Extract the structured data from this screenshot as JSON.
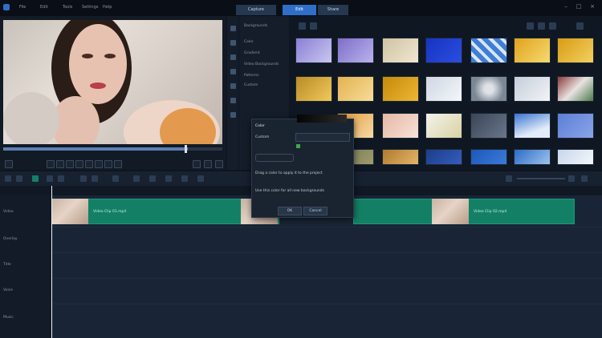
{
  "menu": {
    "items": [
      "File",
      "Edit",
      "Tools",
      "Settings",
      "Help"
    ]
  },
  "workflow_tabs": [
    {
      "label": "Capture",
      "active": false
    },
    {
      "label": "Edit",
      "active": true
    },
    {
      "label": "Share",
      "active": false
    }
  ],
  "window_controls": {
    "minimize": "–",
    "maximize": "□",
    "close": "×"
  },
  "library": {
    "categories": [
      "Backgrounds",
      "Color",
      "Gradient",
      "Video Backgrounds",
      "Patterns",
      "Custom"
    ]
  },
  "dialog": {
    "title_label": "Color",
    "option_label": "Custom",
    "line1": "Drag a color to apply it to the project",
    "line2": "Use this color for all new backgrounds",
    "ok_label": "OK",
    "cancel_label": "Cancel"
  },
  "timeline": {
    "tracks": [
      "Video",
      "Overlay",
      "Title",
      "Voice",
      "Music"
    ],
    "clips": [
      {
        "label": "Video Clip 01.mp4"
      },
      {
        "label": "Video Clip 02.mp4"
      }
    ]
  },
  "colors": {
    "accent": "#2f6fc8",
    "clip": "#138066",
    "bg": "#0d1520"
  }
}
